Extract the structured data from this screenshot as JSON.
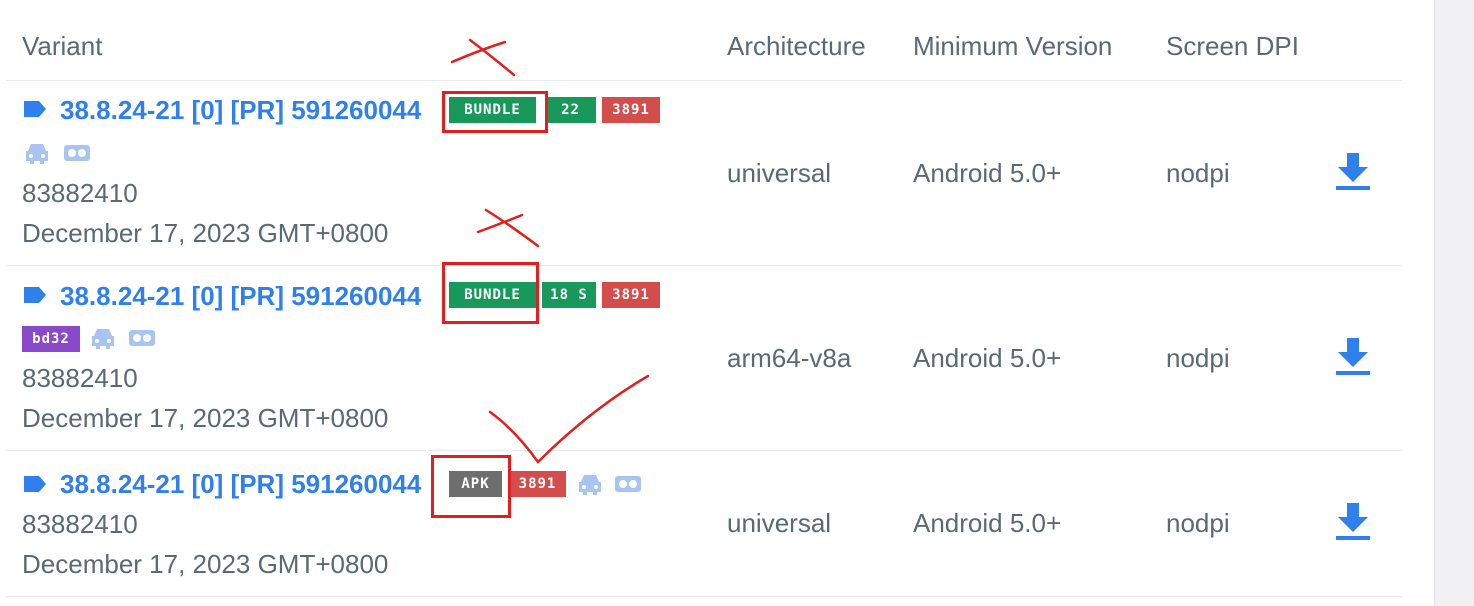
{
  "header": {
    "variant": "Variant",
    "architecture": "Architecture",
    "min_version": "Minimum Version",
    "screen_dpi": "Screen DPI"
  },
  "rows": [
    {
      "version": "38.8.24-21 [0] [PR] 591260044",
      "badges": {
        "type": "BUNDLE",
        "splits": "22 S",
        "num": "3891"
      },
      "code": "83882410",
      "date": "December 17, 2023 GMT+0800",
      "architecture": "universal",
      "min_version": "Android 5.0+",
      "dpi": "nodpi"
    },
    {
      "version": "38.8.24-21 [0] [PR] 591260044",
      "badges": {
        "type": "BUNDLE",
        "splits": "18 S",
        "num": "3891",
        "arch": "bd32"
      },
      "code": "83882410",
      "date": "December 17, 2023 GMT+0800",
      "architecture": "arm64-v8a",
      "min_version": "Android 5.0+",
      "dpi": "nodpi"
    },
    {
      "version": "38.8.24-21 [0] [PR] 591260044",
      "badges": {
        "type": "APK",
        "num": "3891"
      },
      "code": "83882410",
      "date": "December 17, 2023 GMT+0800",
      "architecture": "universal",
      "min_version": "Android 5.0+",
      "dpi": "nodpi"
    }
  ],
  "icons": {
    "tag": "tag-icon",
    "car": "car-icon",
    "vr": "vr-headset-icon",
    "download": "download-icon"
  },
  "colors": {
    "link": "#2f80ed",
    "bundle_badge": "#19985b",
    "count_badge": "#d44d4d",
    "arch_badge": "#8a49c8",
    "apk_badge": "#6e6e6e",
    "annotation": "#e02020"
  }
}
